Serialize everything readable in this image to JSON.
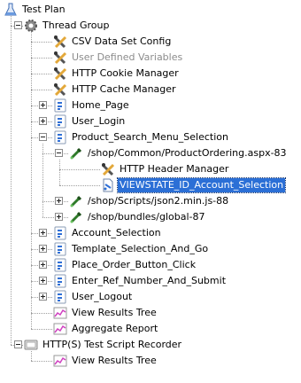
{
  "tree": [
    {
      "label": "Test Plan",
      "icon": "test-plan-icon",
      "depth": 0,
      "toggle": "none"
    },
    {
      "label": "Thread Group",
      "icon": "thread-group-gear-icon",
      "depth": 1,
      "toggle": "minus"
    },
    {
      "label": "CSV Data Set Config",
      "icon": "config-element-icon",
      "depth": 2,
      "toggle": "none"
    },
    {
      "label": "User Defined Variables",
      "icon": "config-element-icon",
      "depth": 2,
      "toggle": "none",
      "disabled": true
    },
    {
      "label": "HTTP Cookie Manager",
      "icon": "config-element-icon",
      "depth": 2,
      "toggle": "none"
    },
    {
      "label": "HTTP Cache Manager",
      "icon": "config-element-icon",
      "depth": 2,
      "toggle": "none"
    },
    {
      "label": "Home_Page",
      "icon": "transaction-controller-icon",
      "depth": 2,
      "toggle": "plus"
    },
    {
      "label": "User_Login",
      "icon": "transaction-controller-icon",
      "depth": 2,
      "toggle": "plus"
    },
    {
      "label": "Product_Search_Menu_Selection",
      "icon": "transaction-controller-icon",
      "depth": 2,
      "toggle": "minus"
    },
    {
      "label": "/shop/Common/ProductOrdering.aspx-83",
      "icon": "http-sampler-pipette-icon",
      "depth": 3,
      "toggle": "minus"
    },
    {
      "label": "HTTP Header Manager",
      "icon": "config-element-icon",
      "depth": 4,
      "toggle": "none"
    },
    {
      "label": "VIEWSTATE_ID_Account_Selection",
      "icon": "regex-extractor-icon",
      "depth": 4,
      "toggle": "none",
      "selected": true
    },
    {
      "label": "/shop/Scripts/json2.min.js-88",
      "icon": "http-sampler-pipette-icon",
      "depth": 3,
      "toggle": "plus"
    },
    {
      "label": "/shop/bundles/global-87",
      "icon": "http-sampler-pipette-icon",
      "depth": 3,
      "toggle": "plus"
    },
    {
      "label": "Account_Selection",
      "icon": "transaction-controller-icon",
      "depth": 2,
      "toggle": "plus"
    },
    {
      "label": "Template_Selection_And_Go",
      "icon": "transaction-controller-icon",
      "depth": 2,
      "toggle": "plus"
    },
    {
      "label": "Place_Order_Button_Click",
      "icon": "transaction-controller-icon",
      "depth": 2,
      "toggle": "plus"
    },
    {
      "label": "Enter_Ref_Number_And_Submit",
      "icon": "transaction-controller-icon",
      "depth": 2,
      "toggle": "plus"
    },
    {
      "label": "User_Logout",
      "icon": "transaction-controller-icon",
      "depth": 2,
      "toggle": "plus"
    },
    {
      "label": "View Results Tree",
      "icon": "listener-graph-icon",
      "depth": 2,
      "toggle": "none"
    },
    {
      "label": "Aggregate Report",
      "icon": "listener-graph-icon",
      "depth": 2,
      "toggle": "none"
    },
    {
      "label": "HTTP(S) Test Script Recorder",
      "icon": "recorder-icon",
      "depth": 1,
      "toggle": "minus"
    },
    {
      "label": "View Results Tree",
      "icon": "listener-graph-icon",
      "depth": 2,
      "toggle": "none"
    }
  ]
}
